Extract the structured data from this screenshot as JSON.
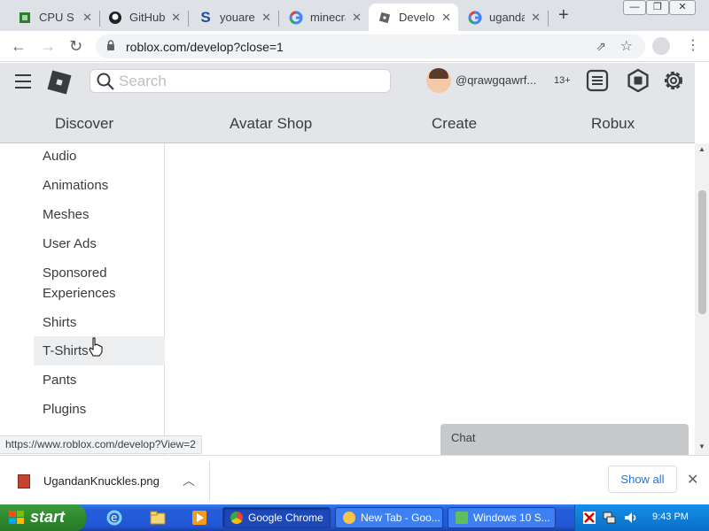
{
  "browser": {
    "tabs": [
      {
        "title": "CPU Stats",
        "icon": "cpu-icon",
        "active": false
      },
      {
        "title": "GitHub",
        "icon": "github-icon",
        "active": false
      },
      {
        "title": "youarean",
        "icon": "s-icon",
        "active": false
      },
      {
        "title": "minecraft",
        "icon": "google-icon",
        "active": false
      },
      {
        "title": "Develop",
        "icon": "roblox-icon",
        "active": true
      },
      {
        "title": "uganda",
        "icon": "google-icon",
        "active": false
      }
    ],
    "url": "roblox.com/develop?close=1"
  },
  "header": {
    "search_placeholder": "Search",
    "username": "@qrawgqawrf...",
    "age_badge": "13+",
    "nav": [
      "Discover",
      "Avatar Shop",
      "Create",
      "Robux"
    ]
  },
  "sidebar": {
    "items": [
      "Audio",
      "Animations",
      "Meshes",
      "User Ads",
      "Sponsored Experiences",
      "Shirts",
      "T-Shirts",
      "Pants",
      "Plugins"
    ],
    "hovered": "T-Shirts"
  },
  "status_url": "https://www.roblox.com/develop?View=2",
  "chat": {
    "label": "Chat"
  },
  "downloads": {
    "filename": "UgandanKnuckles.png",
    "show_all": "Show all"
  },
  "taskbar": {
    "start_label": "start",
    "tasks": [
      "Google Chrome",
      "New Tab - Goo...",
      "Windows 10 S..."
    ],
    "clock": "9:43 PM"
  },
  "colors": {
    "roblox_header_bg": "#e3e5e8",
    "xp_taskbar_blue": "#245edb",
    "xp_start_green": "#2f8a2f",
    "chrome_link_blue": "#1a73e8"
  }
}
